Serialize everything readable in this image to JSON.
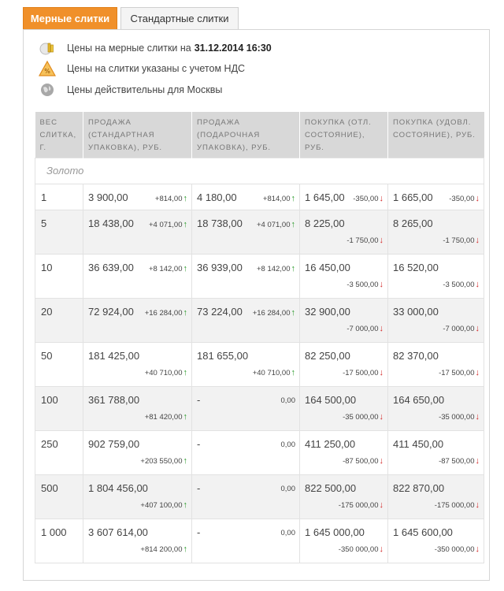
{
  "tabs": {
    "active": "Мерные слитки",
    "inactive": "Стандартные слитки"
  },
  "info": {
    "prices_date_label": "Цены на мерные слитки на",
    "prices_date_value": "31.12.2014 16:30",
    "vat_note": "Цены на слитки указаны с учетом НДС",
    "moscow_note": "Цены действительны для Москвы"
  },
  "table": {
    "headers": [
      "ВЕС СЛИТКА, Г.",
      "ПРОДАЖА (СТАНДАРТНАЯ УПАКОВКА), РУБ.",
      "ПРОДАЖА (ПОДАРОЧНАЯ УПАКОВКА), РУБ.",
      "ПОКУПКА (ОТЛ. СОСТОЯНИЕ), РУБ.",
      "ПОКУПКА (УДОВЛ. СОСТОЯНИЕ), РУБ."
    ],
    "group_label": "Золото",
    "rows": [
      {
        "weight": "1",
        "sale_std": "3 900,00",
        "sale_std_delta": "+814,00",
        "sale_gift": "4 180,00",
        "sale_gift_delta": "+814,00",
        "buy_good": "1 645,00",
        "buy_good_delta": "-350,00",
        "buy_ok": "1 665,00",
        "buy_ok_delta": "-350,00"
      },
      {
        "weight": "5",
        "sale_std": "18 438,00",
        "sale_std_delta": "+4 071,00",
        "sale_gift": "18 738,00",
        "sale_gift_delta": "+4 071,00",
        "buy_good": "8 225,00",
        "buy_good_delta": "-1 750,00",
        "buy_ok": "8 265,00",
        "buy_ok_delta": "-1 750,00"
      },
      {
        "weight": "10",
        "sale_std": "36 639,00",
        "sale_std_delta": "+8 142,00",
        "sale_gift": "36 939,00",
        "sale_gift_delta": "+8 142,00",
        "buy_good": "16 450,00",
        "buy_good_delta": "-3 500,00",
        "buy_ok": "16 520,00",
        "buy_ok_delta": "-3 500,00"
      },
      {
        "weight": "20",
        "sale_std": "72 924,00",
        "sale_std_delta": "+16 284,00",
        "sale_gift": "73 224,00",
        "sale_gift_delta": "+16 284,00",
        "buy_good": "32 900,00",
        "buy_good_delta": "-7 000,00",
        "buy_ok": "33 000,00",
        "buy_ok_delta": "-7 000,00"
      },
      {
        "weight": "50",
        "sale_std": "181 425,00",
        "sale_std_delta": "+40 710,00",
        "sale_gift": "181 655,00",
        "sale_gift_delta": "+40 710,00",
        "buy_good": "82 250,00",
        "buy_good_delta": "-17 500,00",
        "buy_ok": "82 370,00",
        "buy_ok_delta": "-17 500,00"
      },
      {
        "weight": "100",
        "sale_std": "361 788,00",
        "sale_std_delta": "+81 420,00",
        "sale_gift": "-",
        "sale_gift_delta": "0,00",
        "buy_good": "164 500,00",
        "buy_good_delta": "-35 000,00",
        "buy_ok": "164 650,00",
        "buy_ok_delta": "-35 000,00"
      },
      {
        "weight": "250",
        "sale_std": "902 759,00",
        "sale_std_delta": "+203 550,00",
        "sale_gift": "-",
        "sale_gift_delta": "0,00",
        "buy_good": "411 250,00",
        "buy_good_delta": "-87 500,00",
        "buy_ok": "411 450,00",
        "buy_ok_delta": "-87 500,00"
      },
      {
        "weight": "500",
        "sale_std": "1 804 456,00",
        "sale_std_delta": "+407 100,00",
        "sale_gift": "-",
        "sale_gift_delta": "0,00",
        "buy_good": "822 500,00",
        "buy_good_delta": "-175 000,00",
        "buy_ok": "822 870,00",
        "buy_ok_delta": "-175 000,00"
      },
      {
        "weight": "1 000",
        "sale_std": "3 607 614,00",
        "sale_std_delta": "+814 200,00",
        "sale_gift": "-",
        "sale_gift_delta": "0,00",
        "buy_good": "1 645 000,00",
        "buy_good_delta": "-350 000,00",
        "buy_ok": "1 645 600,00",
        "buy_ok_delta": "-350 000,00"
      }
    ]
  },
  "colors": {
    "accent": "#f0902a",
    "up": "#2a9a2a",
    "down": "#d32b2b",
    "header_bg": "#d8d8d8",
    "alt_row_bg": "#f2f2f2"
  }
}
